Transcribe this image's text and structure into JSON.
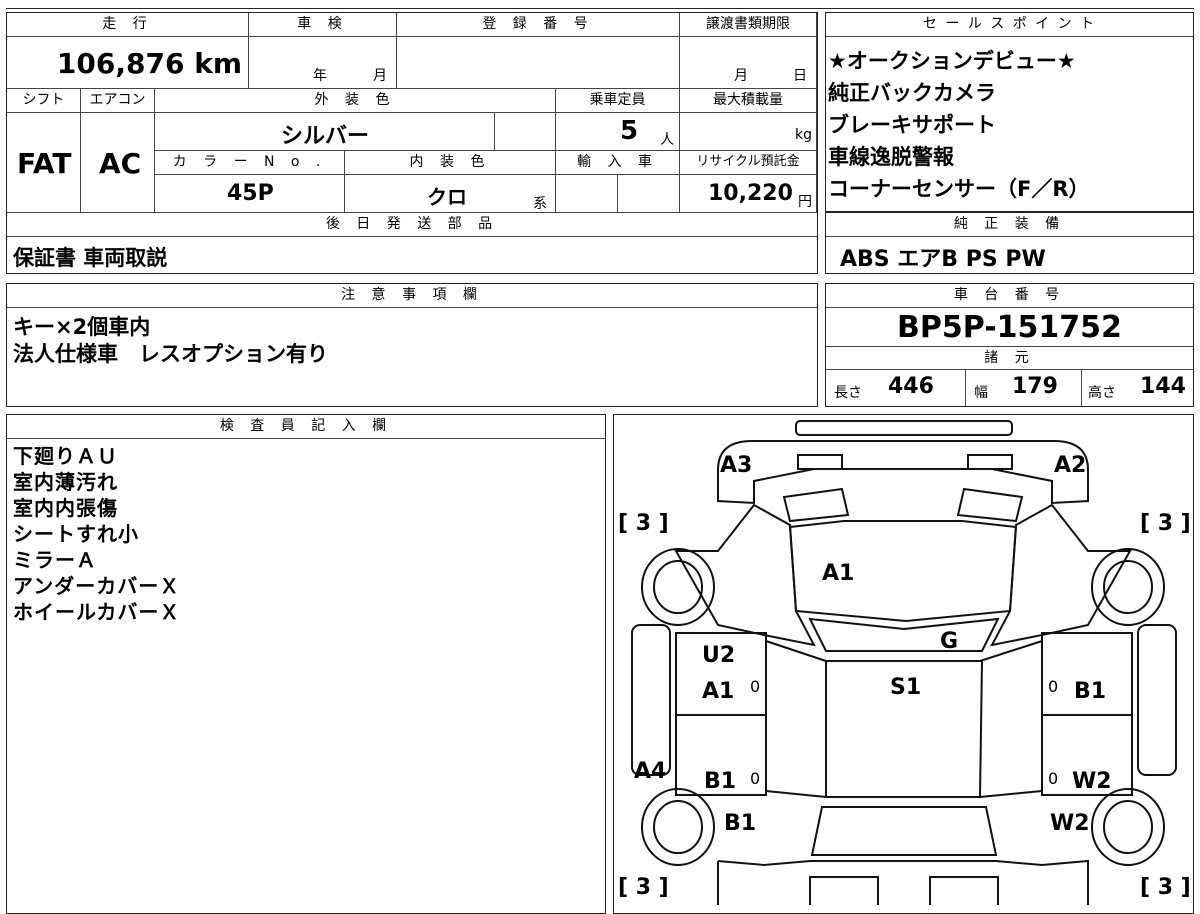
{
  "headers": {
    "mileage": "走 行",
    "shaken": "車 検",
    "reg_no": "登 録 番 号",
    "transfer_deadline": "譲渡書類期限",
    "sales_points": "セ ー ル ス ポ イ ン ト",
    "shift": "シフト",
    "aircon": "エアコン",
    "ext_color": "外 装 色",
    "capacity": "乗車定員",
    "max_load": "最大積載量",
    "color_no": "カ ラ ー N o .",
    "int_color": "内 装 色",
    "import": "輸 入 車",
    "recycle": "リサイクル預託金",
    "later_parts": "後 日 発 送 部 品",
    "factory_equip": "純 正 装 備",
    "notes": "注 意 事 項 欄",
    "chassis_no": "車 台 番 号",
    "specs": "諸 元",
    "inspector": "検 査 員 記 入 欄"
  },
  "values": {
    "mileage": "106,876 km",
    "shaken_year": "年",
    "shaken_month": "月",
    "deadline_month": "月",
    "deadline_day": "日",
    "shift": "FAT",
    "aircon": "AC",
    "ext_color": "シルバー",
    "capacity": "5",
    "capacity_unit": "人",
    "load_unit": "kg",
    "color_no": "45P",
    "int_color": "クロ",
    "int_color_suffix": "系",
    "recycle": "10,220",
    "recycle_unit": "円",
    "later_parts": "保証書 車両取説",
    "factory_equip": "ABS エアB PS PW",
    "chassis_no": "BP5P-151752",
    "length_label": "長さ",
    "length": "446",
    "width_label": "幅",
    "width": "179",
    "height_label": "高さ",
    "height": "144"
  },
  "sales_points": [
    "★オークションデビュー★",
    "純正バックカメラ",
    "ブレーキサポート",
    "車線逸脱警報",
    "コーナーセンサー（F／R）"
  ],
  "notes": [
    "キー×2個車内",
    "法人仕様車　レスオプション有り"
  ],
  "inspector_notes": [
    "下廻りＡＵ",
    "室内薄汚れ",
    "室内内張傷",
    "シートすれ小",
    "ミラーＡ",
    "アンダーカバーＸ",
    "ホイールカバーＸ"
  ],
  "map": {
    "a3": "A3",
    "a2": "A2",
    "a1_roof": "A1",
    "g": "G",
    "s1": "S1",
    "u2": "U2",
    "a1_left": "A1",
    "b1_right": "B1",
    "a4": "A4",
    "b1_left": "B1",
    "w2_right": "W2",
    "b1_bottom_left": "B1",
    "w2_bottom_right": "W2",
    "tire_fl": "[ 3 ]",
    "tire_fr": "[ 3 ]",
    "tire_rl": "[ 3 ]",
    "tire_rr": "[ 3 ]",
    "zero": "0"
  }
}
